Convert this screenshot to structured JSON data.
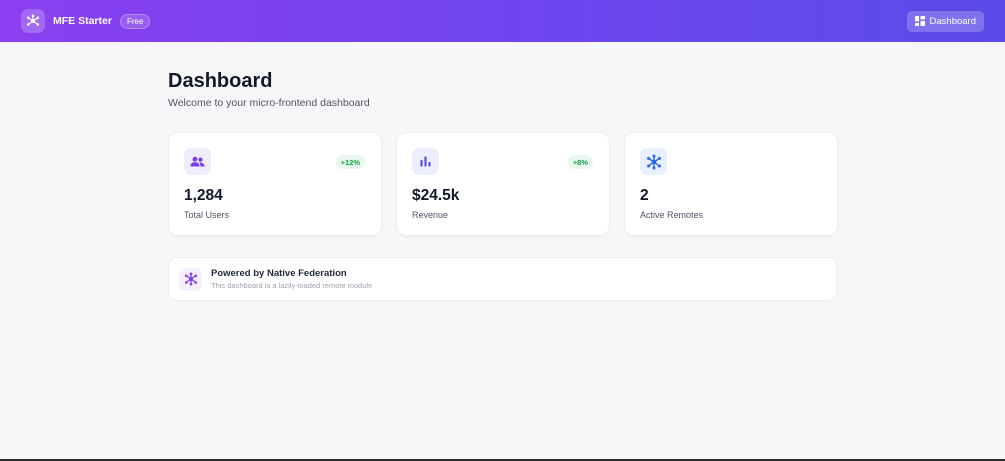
{
  "header": {
    "brand": "MFE Starter",
    "plan_badge": "Free",
    "nav_dashboard_label": "Dashboard",
    "logo_icon": "network-icon",
    "nav_icon": "grid-icon",
    "gradient_colors": [
      "#8b3ff0",
      "#5b4be8"
    ]
  },
  "page": {
    "title": "Dashboard",
    "subtitle": "Welcome to your micro-frontend dashboard"
  },
  "stats": [
    {
      "icon": "users-icon",
      "value": "1,284",
      "label": "Total Users",
      "change": "+12%",
      "icon_bg": "#f1ecfd",
      "icon_color": "#7c3aed"
    },
    {
      "icon": "bar-chart-icon",
      "value": "$24.5k",
      "label": "Revenue",
      "change": "+8%",
      "icon_bg": "#eceefd",
      "icon_color": "#4f46e5"
    },
    {
      "icon": "network-icon",
      "value": "2",
      "label": "Active Remotes",
      "change": null,
      "icon_bg": "#e8efff",
      "icon_color": "#2563eb"
    }
  ],
  "info": {
    "title": "Powered by Native Federation",
    "subtitle": "This dashboard is a lazily-loaded remote module",
    "icon": "network-icon"
  },
  "colors": {
    "accent": "#7c3aed",
    "positive": "#16a34a",
    "positive_bg": "#e9f8ef",
    "background": "#f7f7f9"
  }
}
